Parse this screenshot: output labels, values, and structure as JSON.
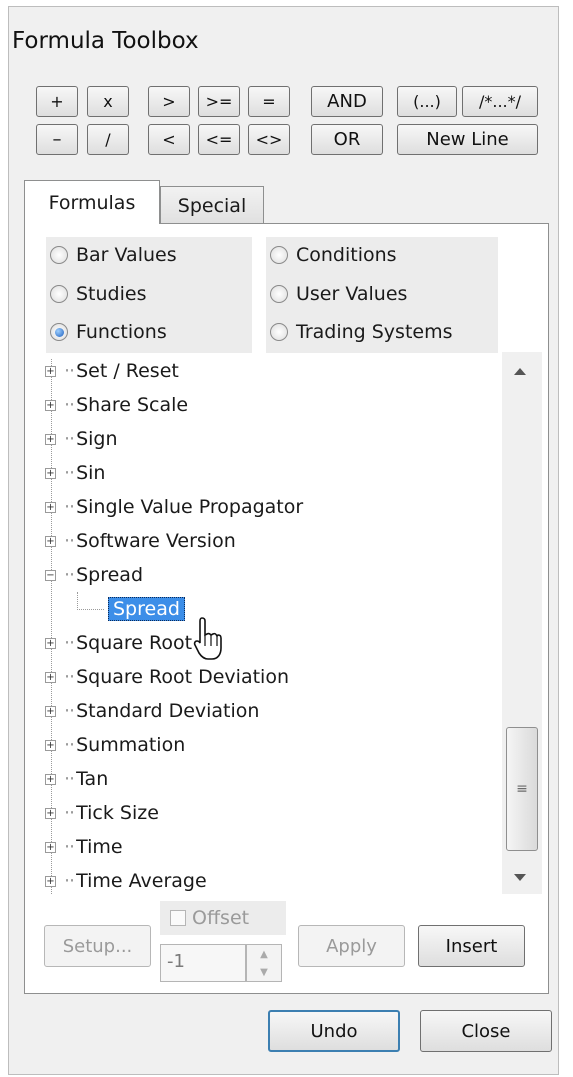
{
  "window": {
    "title": "Formula Toolbox"
  },
  "operators": {
    "row1": [
      "+",
      "x",
      ">",
      ">=",
      "=",
      "AND",
      "(...)",
      "/*...*/"
    ],
    "row2": [
      "–",
      "/",
      "<",
      "<=",
      "<>",
      "OR",
      "New Line"
    ]
  },
  "tabs": [
    {
      "label": "Formulas",
      "active": true
    },
    {
      "label": "Special",
      "active": false
    }
  ],
  "radio_options": [
    {
      "label": "Bar Values",
      "selected": false
    },
    {
      "label": "Studies",
      "selected": false
    },
    {
      "label": "Functions",
      "selected": true
    },
    {
      "label": "Conditions",
      "selected": false
    },
    {
      "label": "User Values",
      "selected": false
    },
    {
      "label": "Trading Systems",
      "selected": false
    }
  ],
  "tree": {
    "items": [
      {
        "label": "Set / Reset",
        "expanded": false
      },
      {
        "label": "Share Scale",
        "expanded": false
      },
      {
        "label": "Sign",
        "expanded": false
      },
      {
        "label": "Sin",
        "expanded": false
      },
      {
        "label": "Single Value Propagator",
        "expanded": false
      },
      {
        "label": "Software Version",
        "expanded": false
      },
      {
        "label": "Spread",
        "expanded": true
      },
      {
        "label": "Spread",
        "child": true,
        "selected": true
      },
      {
        "label": "Square Root",
        "expanded": false
      },
      {
        "label": "Square Root Deviation",
        "expanded": false
      },
      {
        "label": "Standard Deviation",
        "expanded": false
      },
      {
        "label": "Summation",
        "expanded": false
      },
      {
        "label": "Tan",
        "expanded": false
      },
      {
        "label": "Tick Size",
        "expanded": false
      },
      {
        "label": "Time",
        "expanded": false
      },
      {
        "label": "Time Average",
        "expanded": false
      }
    ]
  },
  "controls": {
    "setup_label": "Setup...",
    "offset_label": "Offset",
    "offset_value": "-1",
    "apply_label": "Apply",
    "insert_label": "Insert"
  },
  "footer": {
    "undo_label": "Undo",
    "close_label": "Close"
  },
  "colors": {
    "selection": "#3c8ee8",
    "default_button_border": "#3c7fb1"
  }
}
